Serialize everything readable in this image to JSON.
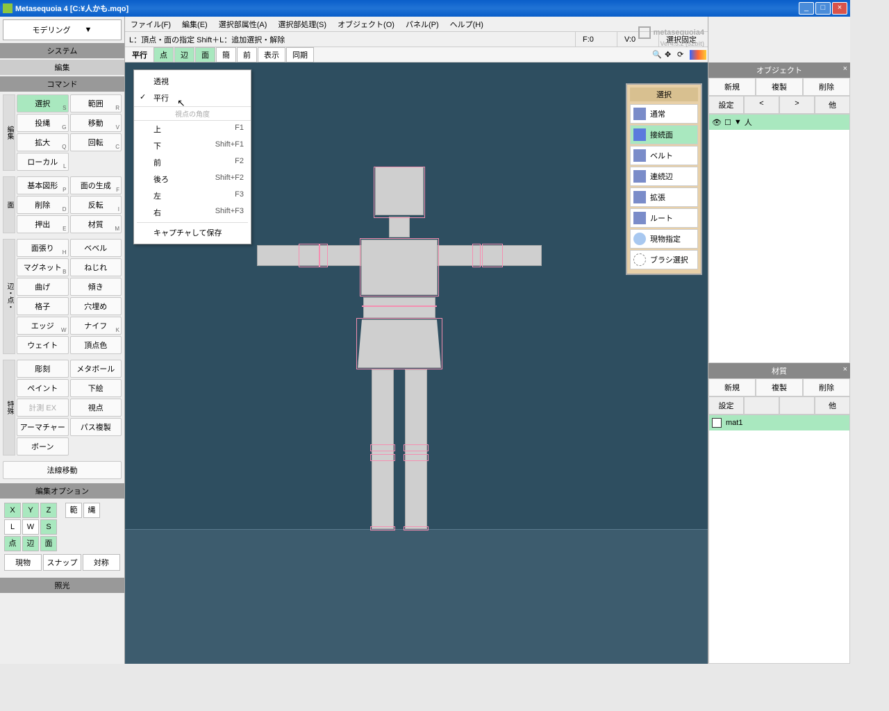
{
  "title": "Metasequoia 4  [C:¥人かも.mqo]",
  "brand": {
    "name": "metasequoia4",
    "ver": "Ver4.3.2 (32bit)"
  },
  "mode": "モデリング",
  "menubar": [
    "ファイル(F)",
    "編集(E)",
    "選択部属性(A)",
    "選択部処理(S)",
    "オブジェクト(O)",
    "パネル(P)",
    "ヘルプ(H)"
  ],
  "status": {
    "hint": "L：頂点・面の指定  Shift＋L：追加選択・解除",
    "f": "F:0",
    "v": "V:0",
    "sel": "選択固定"
  },
  "viewbar": {
    "label": "平行",
    "tabs": [
      "点",
      "辺",
      "面",
      "簡",
      "前",
      "表示",
      "同期"
    ],
    "active": [
      0,
      1,
      2
    ]
  },
  "left": {
    "system": "システム",
    "edit": "編集",
    "command": "コマンド",
    "edit_options": "編集オプション",
    "lighting": "照光",
    "normal_move": "法線移動",
    "side1": "編集",
    "side2": "面",
    "side3": "辺・点・",
    "side4": "特殊",
    "grid1": [
      [
        "選択",
        "S"
      ],
      [
        "範囲",
        "R"
      ],
      [
        "投縄",
        "G"
      ],
      [
        "移動",
        "V"
      ],
      [
        "拡大",
        "Q"
      ],
      [
        "回転",
        "C"
      ],
      [
        "ローカル",
        "L"
      ],
      [
        "",
        ""
      ]
    ],
    "grid2": [
      [
        "基本図形",
        "P"
      ],
      [
        "面の生成",
        "F"
      ],
      [
        "削除",
        "D"
      ],
      [
        "反転",
        "I"
      ],
      [
        "押出",
        "E"
      ],
      [
        "材質",
        "M"
      ]
    ],
    "grid3": [
      [
        "面張り",
        "H"
      ],
      [
        "ベベル",
        ""
      ],
      [
        "マグネット",
        "B"
      ],
      [
        "ねじれ",
        ""
      ],
      [
        "曲げ",
        ""
      ],
      [
        "傾き",
        ""
      ],
      [
        "格子",
        ""
      ],
      [
        "穴埋め",
        ""
      ],
      [
        "エッジ",
        "W"
      ],
      [
        "ナイフ",
        "K"
      ],
      [
        "ウェイト",
        ""
      ],
      [
        "頂点色",
        ""
      ]
    ],
    "grid4": [
      [
        "彫刻",
        ""
      ],
      [
        "メタボール",
        ""
      ],
      [
        "ペイント",
        ""
      ],
      [
        "下絵",
        ""
      ],
      [
        "計測 EX",
        ""
      ],
      [
        "視点",
        ""
      ],
      [
        "アーマチャー",
        ""
      ],
      [
        "パス複製",
        ""
      ],
      [
        "ボーン",
        ""
      ],
      [
        "",
        ""
      ]
    ],
    "opts_xyz": [
      "X",
      "Y",
      "Z"
    ],
    "opts_hn": [
      "範",
      "縄"
    ],
    "opts_lws": [
      "L",
      "W",
      "S"
    ],
    "opts_pve": [
      "点",
      "辺",
      "面"
    ],
    "opts_row": [
      "現物",
      "スナップ",
      "対称"
    ]
  },
  "dropdown": {
    "items": [
      {
        "label": "透視",
        "check": false
      },
      {
        "label": "平行",
        "check": true
      }
    ],
    "sep": "視点の角度",
    "views": [
      {
        "label": "上",
        "key": "F1"
      },
      {
        "label": "下",
        "key": "Shift+F1"
      },
      {
        "label": "前",
        "key": "F2"
      },
      {
        "label": "後ろ",
        "key": "Shift+F2"
      },
      {
        "label": "左",
        "key": "F3"
      },
      {
        "label": "右",
        "key": "Shift+F3"
      }
    ],
    "capture": "キャプチャして保存"
  },
  "float": {
    "title": "選択",
    "items": [
      "通常",
      "接続面",
      "ベルト",
      "連続辺",
      "拡張",
      "ルート",
      "現物指定",
      "ブラシ選択"
    ],
    "active": 1
  },
  "right": {
    "object": {
      "title": "オブジェクト",
      "tabs": [
        "新規",
        "複製",
        "削除"
      ],
      "tabs2": [
        "設定",
        "<",
        ">",
        "他"
      ],
      "item": "人"
    },
    "material": {
      "title": "材質",
      "tabs": [
        "新規",
        "複製",
        "削除"
      ],
      "tabs2": [
        "設定",
        "",
        "",
        "他"
      ],
      "item": "mat1"
    }
  }
}
